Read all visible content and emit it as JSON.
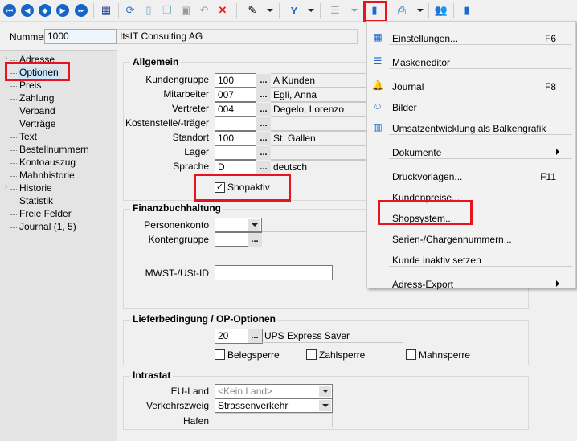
{
  "toolbar": {
    "icons": [
      "first-icon",
      "prev-icon",
      "jump-icon",
      "next-icon",
      "last-icon",
      "table-icon",
      "refresh-icon",
      "new-icon",
      "copy-icon",
      "save-icon",
      "undo-icon",
      "delete-icon",
      "pin-icon",
      "filter-icon",
      "tree-icon",
      "actions-icon",
      "print-icon",
      "users-icon",
      "door-icon"
    ]
  },
  "header": {
    "nummer_label": "Nummer",
    "nummer_value": "1000",
    "company": "ItsIT Consulting AG"
  },
  "sidebar": {
    "items": [
      {
        "label": "Adresse",
        "expandable": true
      },
      {
        "label": "Optionen",
        "selected": true
      },
      {
        "label": "Preis"
      },
      {
        "label": "Zahlung"
      },
      {
        "label": "Verband"
      },
      {
        "label": "Verträge"
      },
      {
        "label": "Text"
      },
      {
        "label": "Bestellnummern"
      },
      {
        "label": "Kontoauszug"
      },
      {
        "label": "Mahnhistorie"
      },
      {
        "label": "Historie",
        "expandable": true
      },
      {
        "label": "Statistik"
      },
      {
        "label": "Freie Felder"
      },
      {
        "label": "Journal (1, 5)"
      }
    ]
  },
  "allgemein": {
    "title": "Allgemein",
    "rows": [
      {
        "label": "Kundengruppe",
        "value": "100",
        "desc": "A Kunden"
      },
      {
        "label": "Mitarbeiter",
        "value": "007",
        "desc": "Egli, Anna"
      },
      {
        "label": "Vertreter",
        "value": "004",
        "desc": "Degelo, Lorenzo"
      },
      {
        "label": "Kostenstelle/-träger",
        "value": "",
        "desc": ""
      },
      {
        "label": "Standort",
        "value": "100",
        "desc": "St. Gallen"
      },
      {
        "label": "Lager",
        "value": "",
        "desc": ""
      },
      {
        "label": "Sprache",
        "value": "D",
        "desc": "deutsch"
      }
    ],
    "ellipsis": "...",
    "shopaktiv_label": "Shopaktiv",
    "shopaktiv_checked": true
  },
  "fibu": {
    "title": "Finanzbuchhaltung",
    "personenkonto_label": "Personenkonto",
    "personenkonto_value": "",
    "kontengruppe_label": "Kontengruppe",
    "kontengruppe_value": "",
    "mwst_label": "MWST-/USt-ID",
    "mwst_value": ""
  },
  "liefer": {
    "title": "Lieferbedingung / OP-Optionen",
    "code": "20",
    "desc": "UPS Express Saver",
    "belegsperre": "Belegsperre",
    "zahlsperre": "Zahlsperre",
    "mahnsperre": "Mahnsperre"
  },
  "intrastat": {
    "title": "Intrastat",
    "euland_label": "EU-Land",
    "euland_value": "<Kein Land>",
    "verkehr_label": "Verkehrszweig",
    "verkehr_value": "Strassenverkehr",
    "hafen_label": "Hafen",
    "hafen_value": ""
  },
  "menu": {
    "items": [
      {
        "label": "Einstellungen...",
        "shortcut": "F6",
        "icon": "settings-icon"
      },
      {
        "label": "Maskeneditor",
        "icon": "mask-editor-icon"
      },
      {
        "label": "Journal",
        "shortcut": "F8",
        "icon": "bell-icon"
      },
      {
        "label": "Bilder",
        "icon": "person-picture-icon"
      },
      {
        "label": "Umsatzentwicklung als Balkengrafik",
        "icon": "bar-chart-icon"
      },
      {
        "label": "Dokumente",
        "submenu": true
      },
      {
        "label": "Druckvorlagen...",
        "shortcut": "F11"
      },
      {
        "label": "Kundenpreise..."
      },
      {
        "label": "Shopsystem..."
      },
      {
        "label": "Serien-/Chargennummern..."
      },
      {
        "label": "Kunde inaktiv setzen"
      },
      {
        "label": "Adress-Export",
        "submenu": true
      }
    ]
  },
  "colors": {
    "highlight": "#e8141c",
    "nav_blue": "#1565c8",
    "selection": "#cce4f7"
  }
}
